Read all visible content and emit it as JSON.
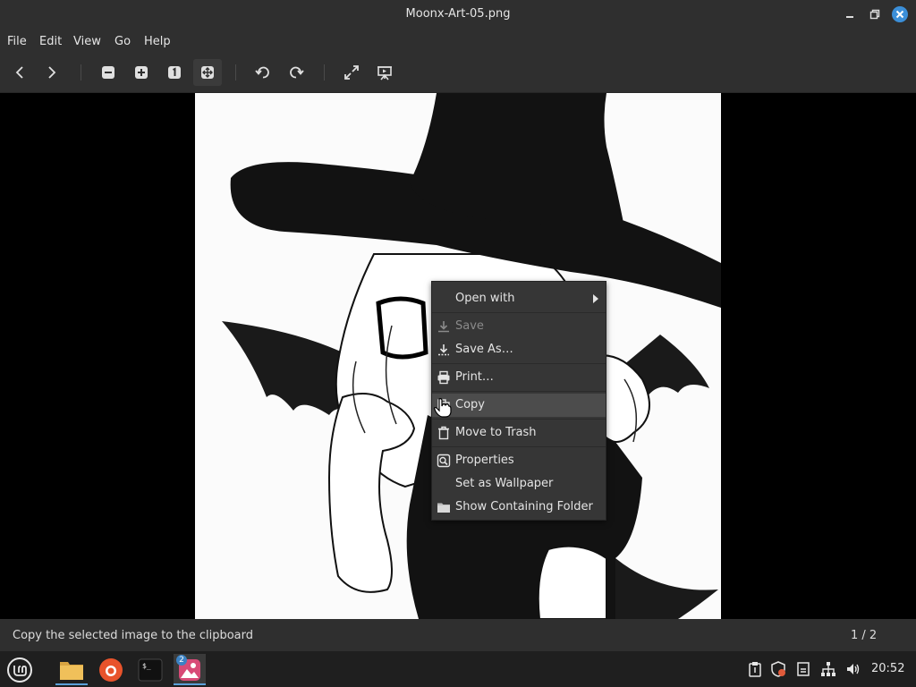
{
  "window": {
    "title": "Moonx-Art-05.png"
  },
  "menu": {
    "items": [
      "File",
      "Edit",
      "View",
      "Go",
      "Help"
    ]
  },
  "toolbar": {
    "buttons": [
      "previous-icon",
      "next-icon",
      "zoom-out-icon",
      "zoom-in-icon",
      "zoom-normal-icon",
      "zoom-fit-icon",
      "rotate-left-icon",
      "rotate-right-icon",
      "fullscreen-icon",
      "slideshow-icon"
    ],
    "pressed": "zoom-fit-icon"
  },
  "context_menu": {
    "items": [
      {
        "label": "Open with",
        "icon": "",
        "submenu": true,
        "disabled": false
      },
      {
        "label": "Save",
        "icon": "save-icon",
        "disabled": true
      },
      {
        "label": "Save As…",
        "icon": "save-as-icon",
        "disabled": false
      },
      {
        "label": "Print…",
        "icon": "print-icon",
        "disabled": false
      },
      {
        "label": "Copy",
        "icon": "copy-icon",
        "disabled": false,
        "highlighted": true
      },
      {
        "label": "Move to Trash",
        "icon": "trash-icon",
        "disabled": false
      },
      {
        "label": "Properties",
        "icon": "properties-icon",
        "disabled": false
      },
      {
        "label": "Set as Wallpaper",
        "icon": "",
        "disabled": false
      },
      {
        "label": "Show Containing Folder",
        "icon": "folder-icon",
        "disabled": false
      }
    ]
  },
  "status": {
    "text": "Copy the selected image to the clipboard",
    "page": "1 / 2"
  },
  "taskbar": {
    "apps": [
      "mint-menu-icon",
      "files-icon",
      "firefox-icon",
      "terminal-icon",
      "image-viewer-icon"
    ],
    "image_viewer_badge": "2",
    "clock": "20:52"
  },
  "colors": {
    "accent": "#5aa0d8",
    "close_button": "#3b8fd9",
    "chrome": "#2f2f2f"
  }
}
